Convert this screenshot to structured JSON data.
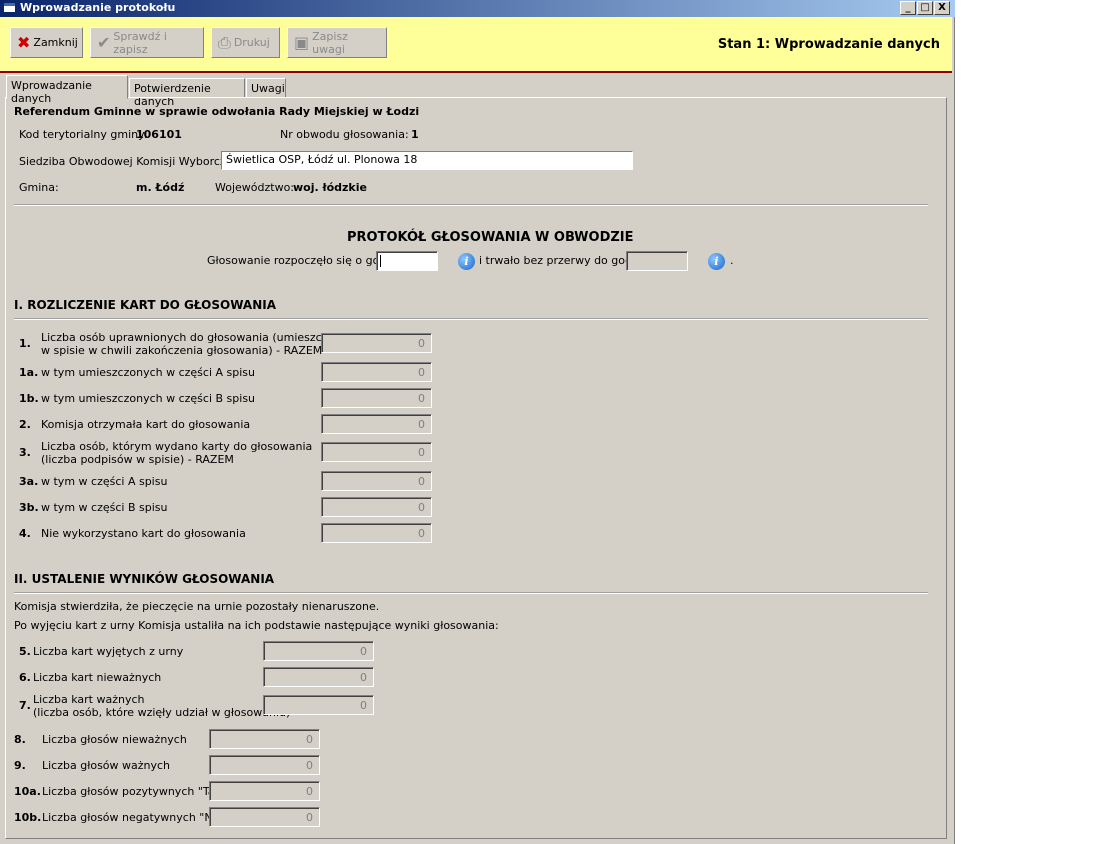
{
  "window": {
    "title": "Wprowadzanie protokołu",
    "controls": [
      "_",
      "□",
      "X"
    ]
  },
  "toolbar": {
    "close": {
      "label": "Zamknij",
      "icon": "close-x-icon"
    },
    "check_save": {
      "label": "Sprawdź i zapisz",
      "icon": "check-save-icon"
    },
    "print": {
      "label": "Drukuj",
      "icon": "printer-icon"
    },
    "save_notes": {
      "label": "Zapisz uwagi",
      "icon": "floppy-icon"
    },
    "status": "Stan 1: Wprowadzanie danych"
  },
  "tabs": [
    "Wprowadzanie danych",
    "Potwierdzenie danych",
    "Uwagi"
  ],
  "header": {
    "title": "Referendum Gminne w sprawie odwołania Rady Miejskiej w Łodzi",
    "kod_label": "Kod terytorialny gminy:",
    "kod_value": "106101",
    "obwod_label": "Nr obwodu głosowania:",
    "obwod_value": "1",
    "siedziba_label": "Siedziba Obwodowej Komisji Wyborczej:",
    "siedziba_value": "Świetlica OSP, Łódź ul. Plonowa 18",
    "gmina_label": "Gmina:",
    "gmina_value": "m. Łódź",
    "woj_label": "Województwo:",
    "woj_value": "woj. łódzkie"
  },
  "protocol": {
    "title": "PROTOKÓŁ GŁOSOWANIA W OBWODZIE",
    "start_label": "Głosowanie rozpoczęło się o godz.",
    "end_label": "i trwało bez przerwy do godz.",
    "end_dot": ".",
    "info_glyph": "i"
  },
  "section1": {
    "title": "I. ROZLICZENIE KART DO GŁOSOWANIA",
    "rows": [
      {
        "num": "1.",
        "line1": "Liczba osób uprawnionych do głosowania (umieszczonych",
        "line2": "w spisie w chwili zakończenia głosowania) - RAZEM",
        "value": "0"
      },
      {
        "num": "1a.",
        "line1": "w tym umieszczonych w części A spisu",
        "line2": "",
        "value": "0"
      },
      {
        "num": "1b.",
        "line1": "w tym umieszczonych w części B spisu",
        "line2": "",
        "value": "0"
      },
      {
        "num": "2.",
        "line1": "Komisja otrzymała kart do głosowania",
        "line2": "",
        "value": "0"
      },
      {
        "num": "3.",
        "line1": "Liczba osób, którym wydano karty do głosowania",
        "line2": "(liczba podpisów w spisie) - RAZEM",
        "value": "0"
      },
      {
        "num": "3a.",
        "line1": "w tym w części A spisu",
        "line2": "",
        "value": "0"
      },
      {
        "num": "3b.",
        "line1": "w tym w części B spisu",
        "line2": "",
        "value": "0"
      },
      {
        "num": "4.",
        "line1": "Nie wykorzystano kart do głosowania",
        "line2": "",
        "value": "0"
      }
    ]
  },
  "section2": {
    "title": "II. USTALENIE WYNIKÓW GŁOSOWANIA",
    "text1": "Komisja stwierdziła, że pieczęcie na urnie pozostały nienaruszone.",
    "text2": "Po wyjęciu kart z urny Komisja ustaliła na ich podstawie następujące wyniki głosowania:",
    "rowsA": [
      {
        "num": "5.",
        "line1": "Liczba kart wyjętych z urny",
        "line2": "",
        "value": "0"
      },
      {
        "num": "6.",
        "line1": "Liczba kart nieważnych",
        "line2": "",
        "value": "0"
      },
      {
        "num": "7.",
        "line1": "Liczba kart ważnych",
        "line2": "(liczba osób, które wzięły udział w głosowaniu)",
        "value": "0"
      }
    ],
    "rowsB": [
      {
        "num": "8.",
        "label": "Liczba głosów nieważnych",
        "value": "0"
      },
      {
        "num": "9.",
        "label": "Liczba głosów ważnych",
        "value": "0"
      },
      {
        "num": "10a.",
        "label": "Liczba głosów pozytywnych \"Tak\"",
        "value": "0"
      },
      {
        "num": "10b.",
        "label": "Liczba głosów negatywnych \"Nie\"",
        "value": "0"
      }
    ]
  }
}
